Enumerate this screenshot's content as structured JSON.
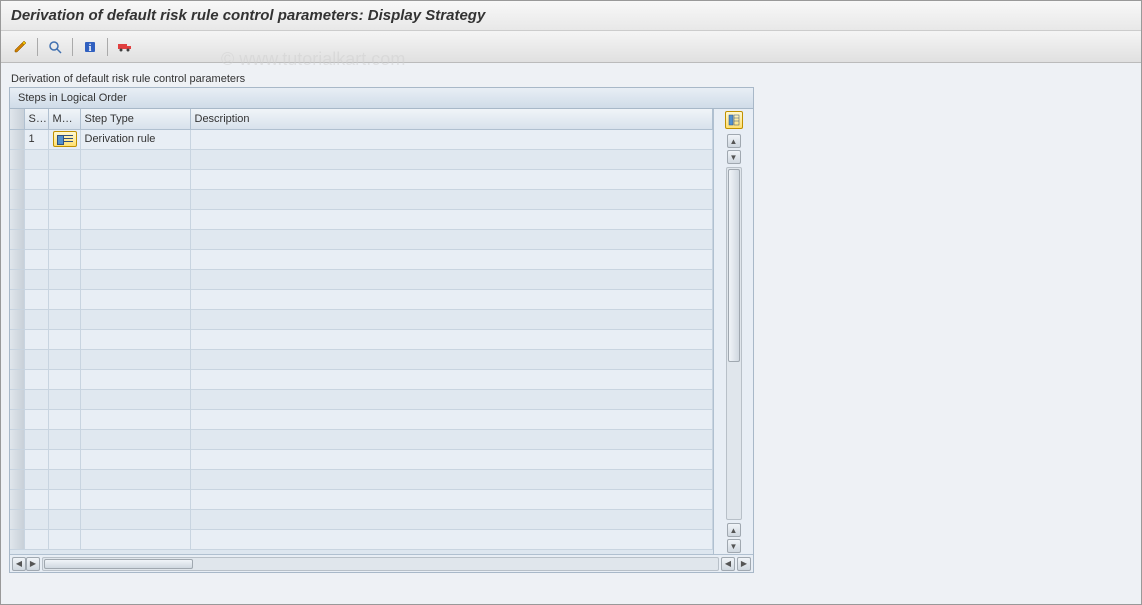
{
  "title": "Derivation of default risk rule control parameters: Display Strategy",
  "toolbar": {
    "icons": [
      "edit",
      "find",
      "info",
      "transport"
    ]
  },
  "section_label": "Derivation of default risk rule control parameters",
  "panel": {
    "title": "Steps in Logical Order",
    "columns": {
      "step": "St...",
      "maint": "Ma...",
      "type": "Step Type",
      "desc": "Description"
    },
    "rows": [
      {
        "step": "1",
        "maint_icon": true,
        "type": "Derivation rule",
        "desc": ""
      }
    ],
    "empty_row_count": 20
  },
  "watermark": "© www.tutorialkart.com"
}
